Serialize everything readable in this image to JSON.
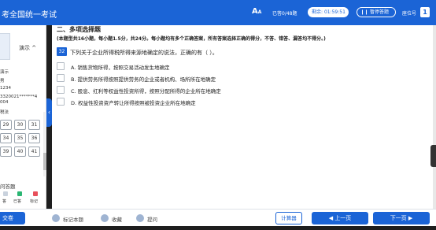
{
  "header": {
    "title": "考全国统一考试",
    "font_control": "A",
    "answered": "已答0/48题",
    "remaining_label": "剩余:",
    "remaining_time": "01:59:51",
    "pause_label": "暂停答题",
    "seat_label": "座位号",
    "seat_number": "1"
  },
  "sidebar": {
    "user_name": "演示",
    "info_lines": [
      "演示",
      "男",
      "1234",
      "3320021*******4",
      "004",
      "税法"
    ],
    "question_numbers": [
      "29",
      "30",
      "31",
      "34",
      "35",
      "36",
      "39",
      "40",
      "41"
    ],
    "ask_title": "问答题",
    "legend": [
      "答",
      "已答",
      "标记"
    ]
  },
  "section": {
    "title": "二、多项选择题",
    "rule": "(本题型共16小题，每小题1.5分，共24分。每小题均有多个正确答案，所有答案选择正确的得分，不答、错答、漏答均不得分。)"
  },
  "question": {
    "number": "32",
    "text": "下列关于企业所得税所得来源地确定的说法，正确的有（  ）。",
    "options": [
      {
        "letter": "A.",
        "text": "销售货物所得，按照交易活动发生地确定"
      },
      {
        "letter": "B.",
        "text": "提供劳务所得按照提供劳务的企业或者机构、场所所在地确定"
      },
      {
        "letter": "C.",
        "text": "股息、红利等权益性投资所得，按照分配所得的企业所在地确定"
      },
      {
        "letter": "D.",
        "text": "权益性投资资产转让所得按照被投资企业所在地确定"
      }
    ]
  },
  "footer": {
    "submit": "交卷",
    "mark": "标记本题",
    "favorite": "收藏",
    "ask": "提问",
    "calculator": "计算器",
    "prev": "上一页",
    "next": "下一页"
  },
  "colors": {
    "primary": "#1b64d6"
  }
}
